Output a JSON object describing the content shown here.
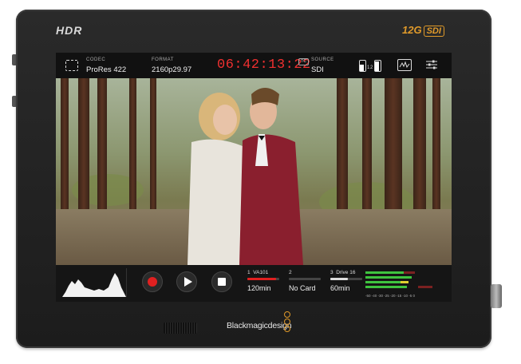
{
  "device": {
    "hdr_logo": "HDR",
    "sdi_logo_prefix": "12G",
    "sdi_logo_suffix": "SDI",
    "brand": "Blackmagicdesign"
  },
  "topbar": {
    "codec_label": "CODEC",
    "codec_value": "ProRes 422",
    "format_label": "FORMAT",
    "format_value": "2160p29.97",
    "timecode": "06:42:13:22",
    "tc_badge": "TC",
    "source_label": "SOURCE",
    "source_value": "SDI",
    "battery_1_label": "1",
    "battery_2_label": "2"
  },
  "bottombar": {
    "slots": [
      {
        "number": "1",
        "name": "VA101",
        "time": "120min",
        "fill": 0.9,
        "color": "#e02020"
      },
      {
        "number": "2",
        "name": "",
        "time": "No Card",
        "fill": 0,
        "color": "#888888"
      },
      {
        "number": "3",
        "name": "Drive 16",
        "time": "60min",
        "fill": 0.55,
        "color": "#dddddd"
      }
    ],
    "meter_scale": "-50 -40 -30 -25 -20 -15 -10 -5 0"
  },
  "colors": {
    "timecode": "#f03030",
    "accent": "#e09a2a",
    "record": "#e02020",
    "meter_green": "#3fc43f",
    "meter_yellow": "#e0d030",
    "meter_red": "#c02a2a"
  }
}
